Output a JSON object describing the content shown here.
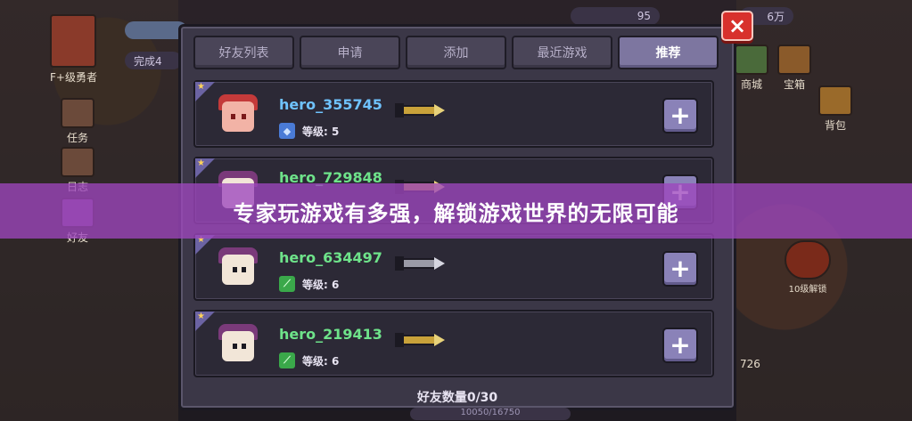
{
  "hud": {
    "left_items": [
      {
        "label": "F+级勇者",
        "icon": "hero-portrait-icon"
      },
      {
        "label": "任务",
        "icon": "task-icon"
      },
      {
        "label": "日志",
        "icon": "log-icon"
      },
      {
        "label": "好友",
        "icon": "friends-icon"
      }
    ],
    "right_items": [
      {
        "label": "商城",
        "icon": "shop-icon"
      },
      {
        "label": "宝箱",
        "icon": "chest-icon"
      },
      {
        "label": "背包",
        "icon": "backpack-icon"
      },
      {
        "label": "10级解锁",
        "icon": "locked-icon"
      }
    ],
    "top_left_pill": "完成4",
    "top_value": "95",
    "top_right_value": "6万",
    "side_number": "726",
    "bottom_exp": "10050/16750"
  },
  "dialog": {
    "tabs": [
      {
        "label": "好友列表",
        "active": false
      },
      {
        "label": "申请",
        "active": false
      },
      {
        "label": "添加",
        "active": false
      },
      {
        "label": "最近游戏",
        "active": false
      },
      {
        "label": "推荐",
        "active": true
      }
    ],
    "close_icon": "×",
    "add_symbol": "+",
    "friends": [
      {
        "name": "hero_355745",
        "name_color": "#6fc3ff",
        "level": "等级: 5",
        "badge_color": "#4a7bd6",
        "badge_icon": "shield-icon",
        "avatar": "red-demon"
      },
      {
        "name": "hero_729848",
        "name_color": "#6ee38a",
        "level": "",
        "badge_color": "#3aa84a",
        "badge_icon": "sword-icon",
        "avatar": "wizard"
      },
      {
        "name": "hero_634497",
        "name_color": "#6ee38a",
        "level": "等级: 6",
        "badge_color": "#3aa84a",
        "badge_icon": "sword-icon",
        "avatar": "wizard"
      },
      {
        "name": "hero_219413",
        "name_color": "#6ee38a",
        "level": "等级: 6",
        "badge_color": "#3aa84a",
        "badge_icon": "sword-icon",
        "avatar": "wizard"
      }
    ],
    "friend_count": "好友数量0/30"
  },
  "banner": {
    "text": "专家玩游戏有多强，解锁游戏世界的无限可能"
  }
}
